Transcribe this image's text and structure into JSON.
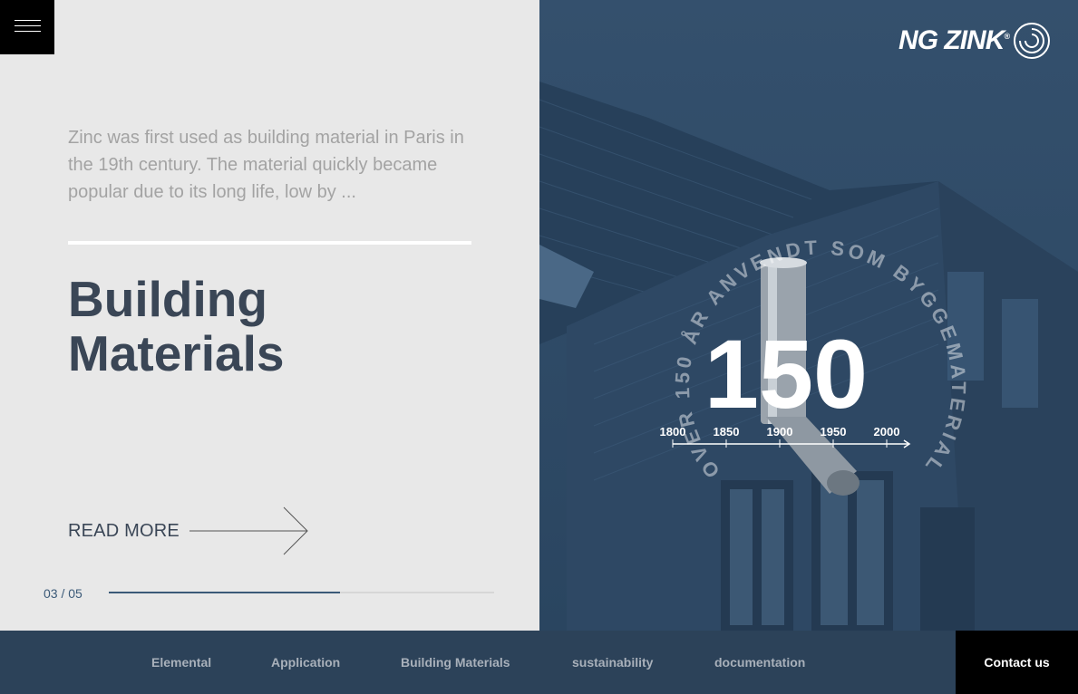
{
  "menu": {
    "icon": "hamburger-icon"
  },
  "intro": {
    "text": "Zinc was first used as building material in Paris in the 19th century. The material quickly became popular due to its long life, low by ..."
  },
  "slide": {
    "title_line1": "Building",
    "title_line2": "Materials",
    "read_more": "READ MORE",
    "arrow_icon": "arrow-right-icon",
    "counter": "03 / 05",
    "progress": 0.6
  },
  "brand": {
    "wordmark": "NG ZINK",
    "registered": "®",
    "mark_icon": "spiral-logo-icon"
  },
  "emblem": {
    "big_number": "150",
    "ring_text": "OVER 150 ÅR ANVENDT SOM BYGGEMATERIALE",
    "timeline": [
      "1800",
      "1850",
      "1900",
      "1950",
      "2000"
    ]
  },
  "nav": {
    "items": [
      "Elemental",
      "Application",
      "Building Materials",
      "sustainability",
      "documentation"
    ],
    "contact": "Contact us"
  },
  "colors": {
    "navy": "#2f4a66",
    "title": "#3a4656",
    "accent": "#3b5a78"
  }
}
